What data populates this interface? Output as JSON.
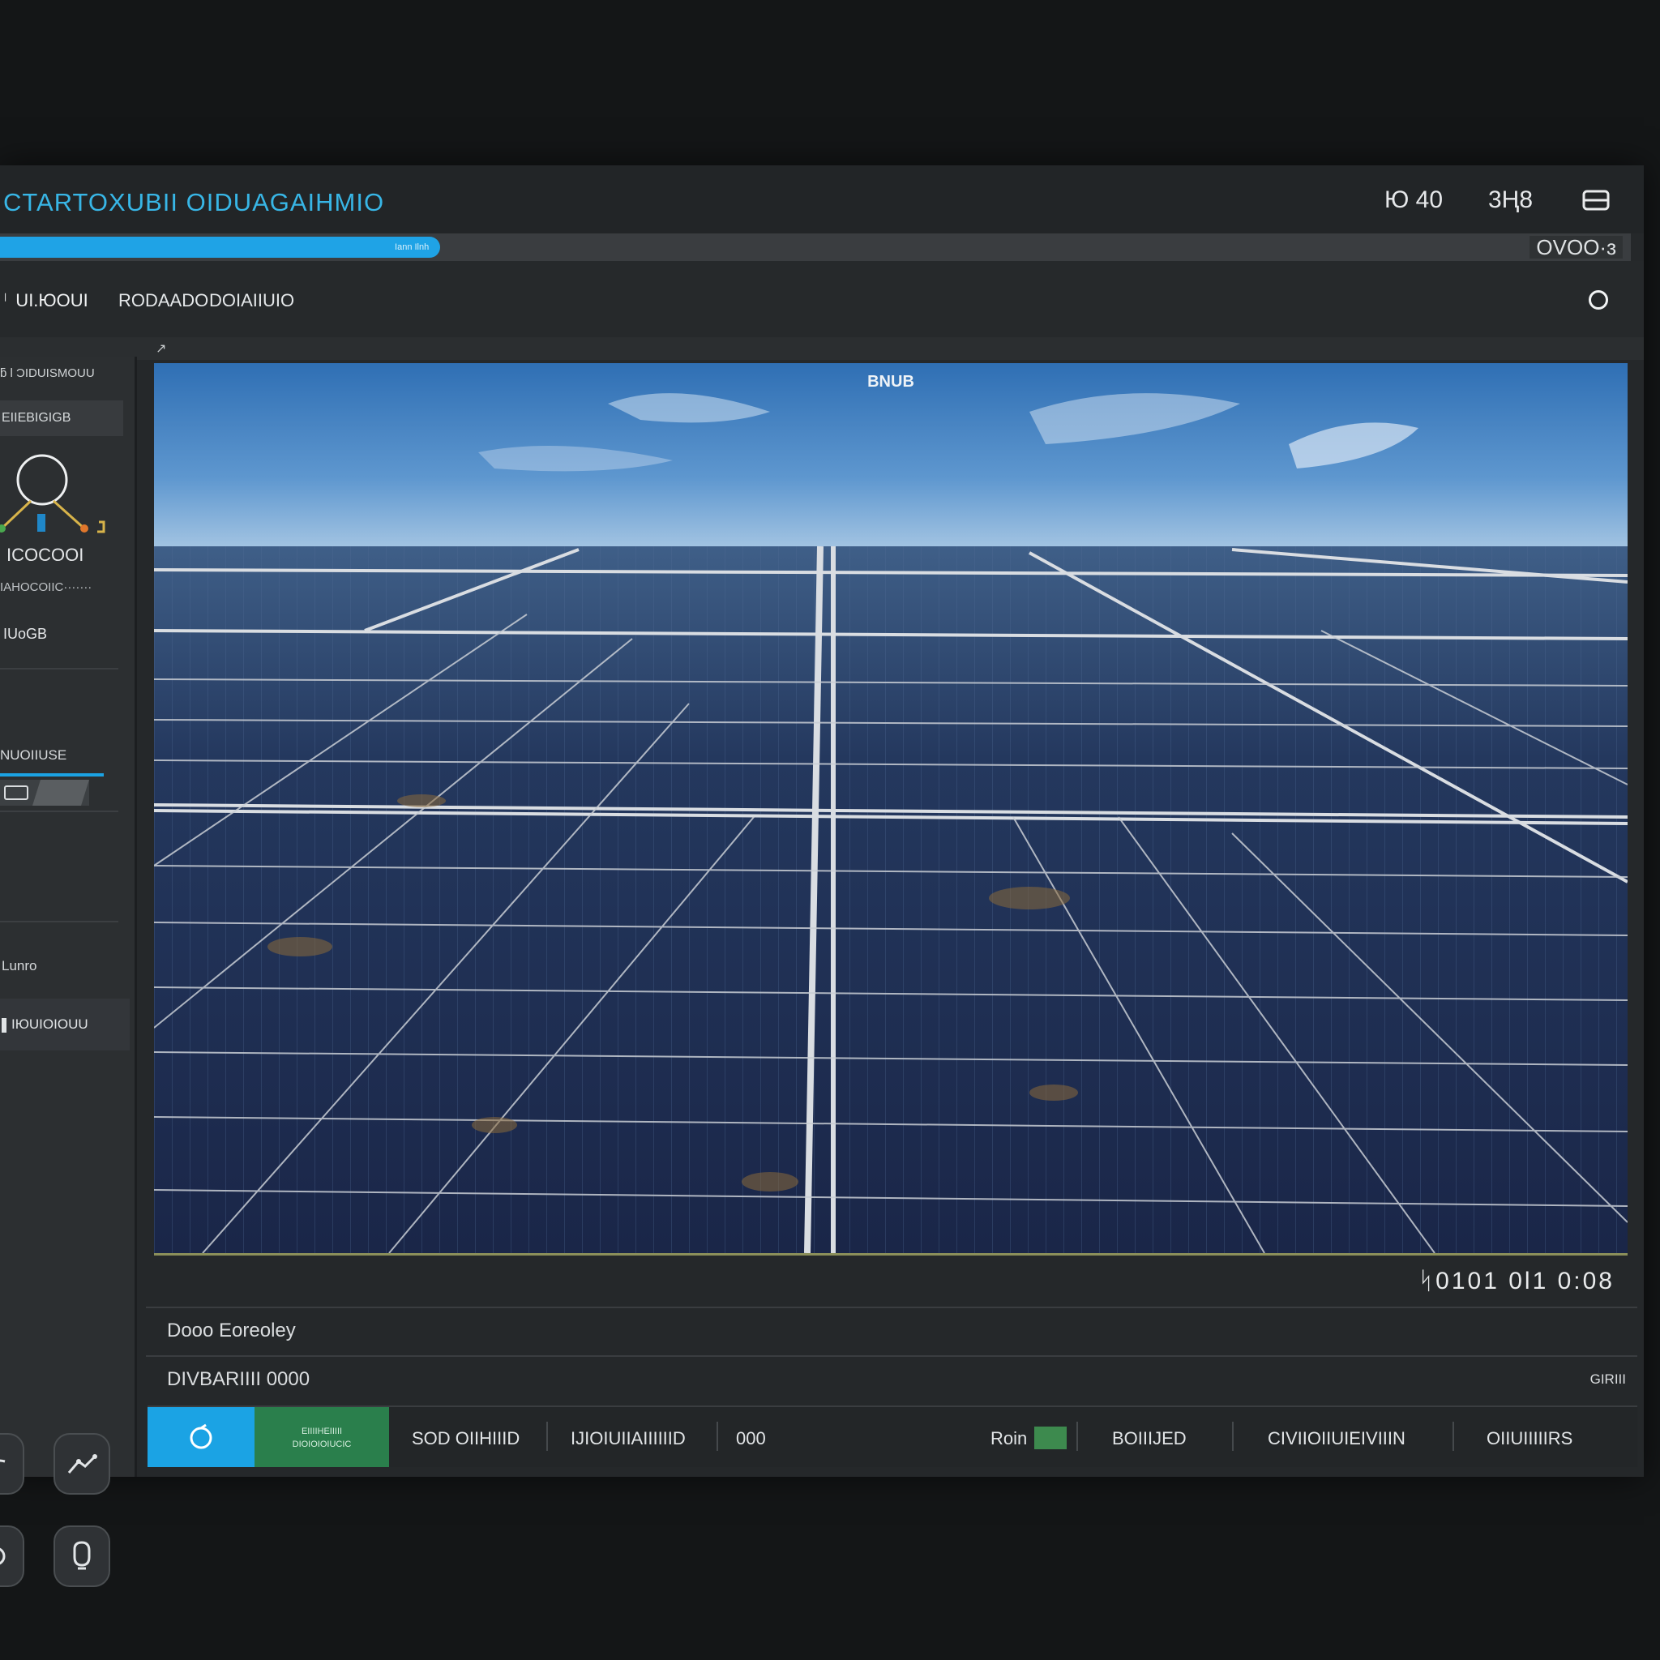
{
  "app": {
    "title": "CTARTOXUBII OIDUAGAIHMIO",
    "window_controls": {
      "a": "Ю 40",
      "b": "3Ң8"
    },
    "menu_icon": "menu-icon"
  },
  "progress": {
    "percent": 27,
    "inner_text": "Iann  Ilnh",
    "value": "OVOO·ɜ",
    "color": "#1fa3e6"
  },
  "toolbar": {
    "item1": "ᛌ UI.ЮOUI",
    "item2": "RODAADO",
    "item3": "DOIAIIUIO",
    "right_icon": "circle-icon"
  },
  "sidebar": {
    "header": "ƃ Ɩ ƆIDUISMOUU",
    "tab": "EIIEBIGIGB",
    "value": "ICOCOOI",
    "line": "IAHOCOIIC·······",
    "val2": "IUoGB",
    "label3": "NUOIIUSE",
    "label4": "Lunro",
    "active_item": "IЮUIOIOUU",
    "buttons": [
      "link-icon",
      "graph-icon",
      "settings-icon",
      "face-icon"
    ]
  },
  "viewport": {
    "label": "BNUB"
  },
  "coords": "ᛋ0101  0Ɩ1  0:08",
  "info": {
    "row1": "Dooo  Eoreoley",
    "row2": "DIVBARIIII  0000",
    "row2_right": "GIRIII"
  },
  "status": {
    "green_text": "EIIIIHEIIIII\nDIOIOIOIUCIC",
    "items": [
      "SOD OIIHIIID",
      "IJIOIUIIAIIIIIID",
      "000",
      "Roin",
      "BOIIIJED",
      "CIVIIOIIUIEIVIIIN",
      "OIIUIIIIIRS"
    ],
    "swatch_color": "#3d8a4e"
  }
}
